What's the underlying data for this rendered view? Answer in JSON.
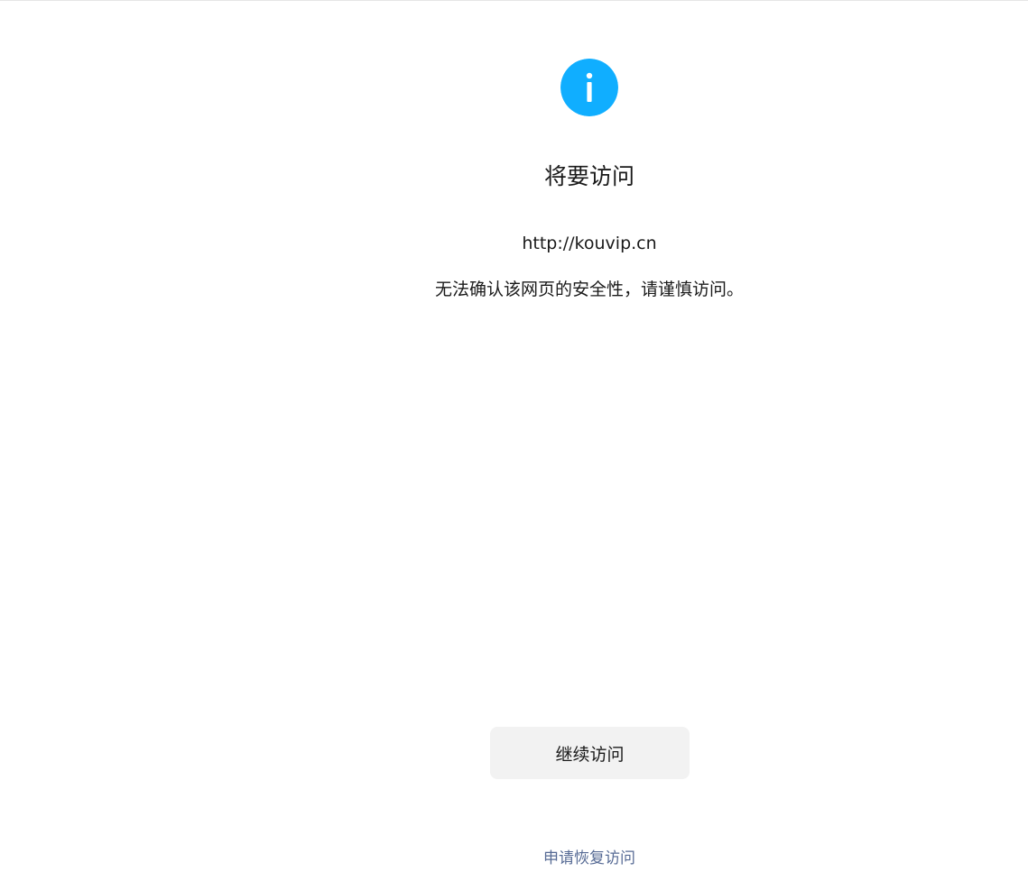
{
  "page": {
    "title": "将要访问",
    "url": "http://kouvip.cn",
    "warning": "无法确认该网页的安全性，请谨慎访问。"
  },
  "icon": {
    "name": "info-icon",
    "color": "#10aeff"
  },
  "actions": {
    "continue_label": "继续访问",
    "restore_label": "申请恢复访问"
  },
  "colors": {
    "button_bg": "#f2f2f2",
    "link": "#576b95"
  }
}
